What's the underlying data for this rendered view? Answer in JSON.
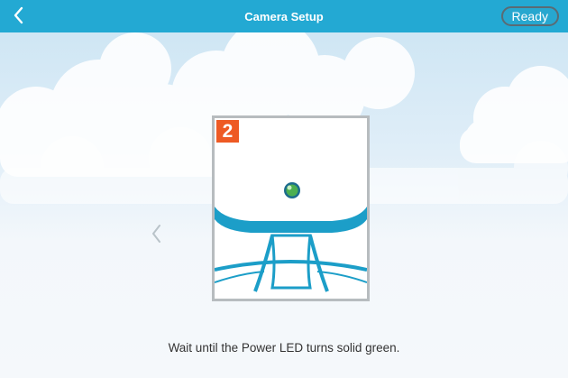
{
  "header": {
    "title": "Camera Setup",
    "ready_label": "Ready",
    "back_icon": "chevron-left-icon"
  },
  "step": {
    "number": "2",
    "instruction": "Wait until the Power LED turns solid green."
  },
  "navigation": {
    "prev_icon": "chevron-left-icon"
  },
  "colors": {
    "header": "#23a9d3",
    "badge": "#ee5a24",
    "camera": "#1c9ec8",
    "led": "#4caf50"
  }
}
